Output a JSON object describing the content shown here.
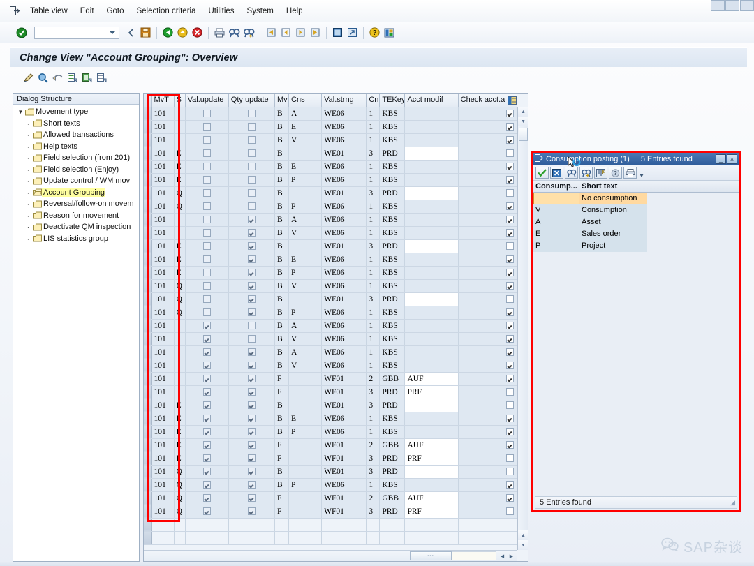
{
  "menubar": {
    "items": [
      "Table view",
      "Edit",
      "Goto",
      "Selection criteria",
      "Utilities",
      "System",
      "Help"
    ],
    "leading_icon": "session-exit-icon"
  },
  "toolbar": {
    "command_value": "",
    "icons": [
      "enter-check-icon",
      "back-arrow-icon",
      "save-icon",
      "back-green-icon",
      "exit-yellow-icon",
      "cancel-red-icon",
      "print-icon",
      "find-icon",
      "find-next-icon",
      "first-page-icon",
      "previous-page-icon",
      "next-page-icon",
      "last-page-icon",
      "new-session-icon",
      "create-shortcut-icon",
      "help-icon",
      "layout-menu-icon"
    ]
  },
  "title": "Change View \"Account Grouping\": Overview",
  "app_toolbar": {
    "icons": [
      "new-entries-icon",
      "display-details-icon",
      "undo-icon",
      "copy-as-icon",
      "paste-icon",
      "delete-icon"
    ]
  },
  "sidebar": {
    "header": "Dialog Structure",
    "root": "Movement type",
    "items": [
      {
        "label": "Short texts",
        "selected": false
      },
      {
        "label": "Allowed transactions",
        "selected": false
      },
      {
        "label": "Help texts",
        "selected": false
      },
      {
        "label": "Field selection (from 201)",
        "selected": false
      },
      {
        "label": "Field selection (Enjoy)",
        "selected": false
      },
      {
        "label": "Update control / WM mov",
        "selected": false
      },
      {
        "label": "Account Grouping",
        "selected": true
      },
      {
        "label": "Reversal/follow-on movem",
        "selected": false
      },
      {
        "label": "Reason for movement",
        "selected": false
      },
      {
        "label": "Deactivate QM inspection",
        "selected": false
      },
      {
        "label": "LIS statistics group",
        "selected": false
      }
    ]
  },
  "grid": {
    "columns": [
      "MvT",
      "S",
      "Val.update",
      "Qty update",
      "Mvt",
      "Cns",
      "Val.strng",
      "Cn",
      "TEKey",
      "Acct modif",
      "Check acct.a"
    ],
    "highlighted_column": "Cns",
    "config_icon": "table-settings-icon",
    "rows": [
      {
        "mvt": "101",
        "s": "",
        "val_update": false,
        "qty_update": false,
        "mvt2": "B",
        "cns": "A",
        "val_strng": "WE06",
        "cn": "1",
        "tekey": "KBS",
        "acct_modif": "",
        "acct_modif_input": false,
        "check_acct": true
      },
      {
        "mvt": "101",
        "s": "",
        "val_update": false,
        "qty_update": false,
        "mvt2": "B",
        "cns": "E",
        "val_strng": "WE06",
        "cn": "1",
        "tekey": "KBS",
        "acct_modif": "",
        "acct_modif_input": false,
        "check_acct": true
      },
      {
        "mvt": "101",
        "s": "",
        "val_update": false,
        "qty_update": false,
        "mvt2": "B",
        "cns": "V",
        "val_strng": "WE06",
        "cn": "1",
        "tekey": "KBS",
        "acct_modif": "",
        "acct_modif_input": false,
        "check_acct": true
      },
      {
        "mvt": "101",
        "s": "E",
        "val_update": false,
        "qty_update": false,
        "mvt2": "B",
        "cns": "",
        "val_strng": "WE01",
        "cn": "3",
        "tekey": "PRD",
        "acct_modif": "",
        "acct_modif_input": true,
        "check_acct": false
      },
      {
        "mvt": "101",
        "s": "E",
        "val_update": false,
        "qty_update": false,
        "mvt2": "B",
        "cns": "E",
        "val_strng": "WE06",
        "cn": "1",
        "tekey": "KBS",
        "acct_modif": "",
        "acct_modif_input": false,
        "check_acct": true
      },
      {
        "mvt": "101",
        "s": "E",
        "val_update": false,
        "qty_update": false,
        "mvt2": "B",
        "cns": "P",
        "val_strng": "WE06",
        "cn": "1",
        "tekey": "KBS",
        "acct_modif": "",
        "acct_modif_input": false,
        "check_acct": true
      },
      {
        "mvt": "101",
        "s": "Q",
        "val_update": false,
        "qty_update": false,
        "mvt2": "B",
        "cns": "",
        "val_strng": "WE01",
        "cn": "3",
        "tekey": "PRD",
        "acct_modif": "",
        "acct_modif_input": true,
        "check_acct": false
      },
      {
        "mvt": "101",
        "s": "Q",
        "val_update": false,
        "qty_update": false,
        "mvt2": "B",
        "cns": "P",
        "val_strng": "WE06",
        "cn": "1",
        "tekey": "KBS",
        "acct_modif": "",
        "acct_modif_input": false,
        "check_acct": true
      },
      {
        "mvt": "101",
        "s": "",
        "val_update": false,
        "qty_update": true,
        "mvt2": "B",
        "cns": "A",
        "val_strng": "WE06",
        "cn": "1",
        "tekey": "KBS",
        "acct_modif": "",
        "acct_modif_input": false,
        "check_acct": true
      },
      {
        "mvt": "101",
        "s": "",
        "val_update": false,
        "qty_update": true,
        "mvt2": "B",
        "cns": "V",
        "val_strng": "WE06",
        "cn": "1",
        "tekey": "KBS",
        "acct_modif": "",
        "acct_modif_input": false,
        "check_acct": true
      },
      {
        "mvt": "101",
        "s": "E",
        "val_update": false,
        "qty_update": true,
        "mvt2": "B",
        "cns": "",
        "val_strng": "WE01",
        "cn": "3",
        "tekey": "PRD",
        "acct_modif": "",
        "acct_modif_input": true,
        "check_acct": false
      },
      {
        "mvt": "101",
        "s": "E",
        "val_update": false,
        "qty_update": true,
        "mvt2": "B",
        "cns": "E",
        "val_strng": "WE06",
        "cn": "1",
        "tekey": "KBS",
        "acct_modif": "",
        "acct_modif_input": false,
        "check_acct": true
      },
      {
        "mvt": "101",
        "s": "E",
        "val_update": false,
        "qty_update": true,
        "mvt2": "B",
        "cns": "P",
        "val_strng": "WE06",
        "cn": "1",
        "tekey": "KBS",
        "acct_modif": "",
        "acct_modif_input": false,
        "check_acct": true
      },
      {
        "mvt": "101",
        "s": "Q",
        "val_update": false,
        "qty_update": true,
        "mvt2": "B",
        "cns": "V",
        "val_strng": "WE06",
        "cn": "1",
        "tekey": "KBS",
        "acct_modif": "",
        "acct_modif_input": false,
        "check_acct": true
      },
      {
        "mvt": "101",
        "s": "Q",
        "val_update": false,
        "qty_update": true,
        "mvt2": "B",
        "cns": "",
        "val_strng": "WE01",
        "cn": "3",
        "tekey": "PRD",
        "acct_modif": "",
        "acct_modif_input": true,
        "check_acct": false
      },
      {
        "mvt": "101",
        "s": "Q",
        "val_update": false,
        "qty_update": true,
        "mvt2": "B",
        "cns": "P",
        "val_strng": "WE06",
        "cn": "1",
        "tekey": "KBS",
        "acct_modif": "",
        "acct_modif_input": false,
        "check_acct": true
      },
      {
        "mvt": "101",
        "s": "",
        "val_update": true,
        "qty_update": false,
        "mvt2": "B",
        "cns": "A",
        "val_strng": "WE06",
        "cn": "1",
        "tekey": "KBS",
        "acct_modif": "",
        "acct_modif_input": false,
        "check_acct": true
      },
      {
        "mvt": "101",
        "s": "",
        "val_update": true,
        "qty_update": false,
        "mvt2": "B",
        "cns": "V",
        "val_strng": "WE06",
        "cn": "1",
        "tekey": "KBS",
        "acct_modif": "",
        "acct_modif_input": false,
        "check_acct": true
      },
      {
        "mvt": "101",
        "s": "",
        "val_update": true,
        "qty_update": true,
        "mvt2": "B",
        "cns": "A",
        "val_strng": "WE06",
        "cn": "1",
        "tekey": "KBS",
        "acct_modif": "",
        "acct_modif_input": false,
        "check_acct": true
      },
      {
        "mvt": "101",
        "s": "",
        "val_update": true,
        "qty_update": true,
        "mvt2": "B",
        "cns": "V",
        "val_strng": "WE06",
        "cn": "1",
        "tekey": "KBS",
        "acct_modif": "",
        "acct_modif_input": false,
        "check_acct": true
      },
      {
        "mvt": "101",
        "s": "",
        "val_update": true,
        "qty_update": true,
        "mvt2": "F",
        "cns": "",
        "val_strng": "WF01",
        "cn": "2",
        "tekey": "GBB",
        "acct_modif": "AUF",
        "acct_modif_input": true,
        "check_acct": true
      },
      {
        "mvt": "101",
        "s": "",
        "val_update": true,
        "qty_update": true,
        "mvt2": "F",
        "cns": "",
        "val_strng": "WF01",
        "cn": "3",
        "tekey": "PRD",
        "acct_modif": "PRF",
        "acct_modif_input": true,
        "check_acct": false
      },
      {
        "mvt": "101",
        "s": "E",
        "val_update": true,
        "qty_update": true,
        "mvt2": "B",
        "cns": "",
        "val_strng": "WE01",
        "cn": "3",
        "tekey": "PRD",
        "acct_modif": "",
        "acct_modif_input": true,
        "check_acct": false
      },
      {
        "mvt": "101",
        "s": "E",
        "val_update": true,
        "qty_update": true,
        "mvt2": "B",
        "cns": "E",
        "val_strng": "WE06",
        "cn": "1",
        "tekey": "KBS",
        "acct_modif": "",
        "acct_modif_input": false,
        "check_acct": true
      },
      {
        "mvt": "101",
        "s": "E",
        "val_update": true,
        "qty_update": true,
        "mvt2": "B",
        "cns": "P",
        "val_strng": "WE06",
        "cn": "1",
        "tekey": "KBS",
        "acct_modif": "",
        "acct_modif_input": false,
        "check_acct": true
      },
      {
        "mvt": "101",
        "s": "E",
        "val_update": true,
        "qty_update": true,
        "mvt2": "F",
        "cns": "",
        "val_strng": "WF01",
        "cn": "2",
        "tekey": "GBB",
        "acct_modif": "AUF",
        "acct_modif_input": true,
        "check_acct": true
      },
      {
        "mvt": "101",
        "s": "E",
        "val_update": true,
        "qty_update": true,
        "mvt2": "F",
        "cns": "",
        "val_strng": "WF01",
        "cn": "3",
        "tekey": "PRD",
        "acct_modif": "PRF",
        "acct_modif_input": true,
        "check_acct": false
      },
      {
        "mvt": "101",
        "s": "Q",
        "val_update": true,
        "qty_update": true,
        "mvt2": "B",
        "cns": "",
        "val_strng": "WE01",
        "cn": "3",
        "tekey": "PRD",
        "acct_modif": "",
        "acct_modif_input": true,
        "check_acct": false
      },
      {
        "mvt": "101",
        "s": "Q",
        "val_update": true,
        "qty_update": true,
        "mvt2": "B",
        "cns": "P",
        "val_strng": "WE06",
        "cn": "1",
        "tekey": "KBS",
        "acct_modif": "",
        "acct_modif_input": false,
        "check_acct": true
      },
      {
        "mvt": "101",
        "s": "Q",
        "val_update": true,
        "qty_update": true,
        "mvt2": "F",
        "cns": "",
        "val_strng": "WF01",
        "cn": "2",
        "tekey": "GBB",
        "acct_modif": "AUF",
        "acct_modif_input": true,
        "check_acct": true
      },
      {
        "mvt": "101",
        "s": "Q",
        "val_update": true,
        "qty_update": true,
        "mvt2": "F",
        "cns": "",
        "val_strng": "WF01",
        "cn": "3",
        "tekey": "PRD",
        "acct_modif": "PRF",
        "acct_modif_input": true,
        "check_acct": false
      }
    ]
  },
  "popup": {
    "title": "Consumption posting (1)",
    "count_label": "5 Entries found",
    "minimize_glyph": "_",
    "close_glyph": "×",
    "toolbar_icons": [
      "check-green-icon",
      "cancel-blue-icon",
      "find-icon",
      "find-next-icon",
      "sort-filter-icon",
      "help-icon",
      "print-icon",
      "menu-arrow-icon"
    ],
    "columns": [
      "Consump...",
      "Short text"
    ],
    "rows": [
      {
        "key": "",
        "text": "No consumption",
        "selected": true
      },
      {
        "key": "V",
        "text": "Consumption",
        "selected": false
      },
      {
        "key": "A",
        "text": "Asset",
        "selected": false
      },
      {
        "key": "E",
        "text": "Sales order",
        "selected": false
      },
      {
        "key": "P",
        "text": "Project",
        "selected": false
      }
    ],
    "status": "5 Entries found"
  },
  "watermark": {
    "text": "SAP杂谈",
    "icon": "wechat-icon"
  },
  "colors": {
    "highlight_red": "#ff0000",
    "selection_yellow": "#ffffa0",
    "popup_title_blue": "#2e5c9a",
    "grid_row_bg": "#dfe8f2"
  }
}
